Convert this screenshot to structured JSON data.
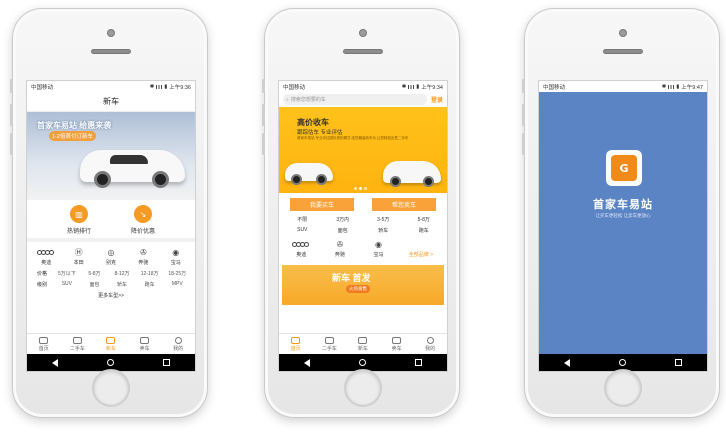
{
  "status": {
    "carrier": "中国移动",
    "time1": "上午9:36",
    "time2": "上午9:34",
    "time3": "上午9:47",
    "battery_icon": "battery-icon",
    "bluetooth_icon": "bluetooth-icon"
  },
  "tabbar": {
    "items": [
      "首页",
      "二手车",
      "新车",
      "卖车",
      "我的"
    ]
  },
  "screen1": {
    "title": "新车",
    "banner_headline": "首家车易站 给惠来袭",
    "banner_sub": "1-2倍首付订新车",
    "quick": [
      "热销排行",
      "降价优惠"
    ],
    "brands": [
      "奥迪",
      "本田",
      "别克",
      "奔驰",
      "宝马"
    ],
    "price_label": "价格",
    "prices": [
      "5万以下",
      "5-8万",
      "8-12万",
      "12-18万",
      "18-25万"
    ],
    "level_label": "级别",
    "levels": [
      "SUV",
      "面包",
      "轿车",
      "跑车",
      "MPV"
    ],
    "more": "更多车型>>"
  },
  "screen2": {
    "search_placeholder": "搜索您想要的车",
    "login": "登录",
    "banner_title": "高价收车",
    "banner_sub": "跟踪估车  专业评估",
    "banner_desc": "首家车易站 专业评估团队竞拍模式 给您最高收车价 让您轻松出售二手车",
    "buy_btn": "我要买车",
    "sell_btn": "帮您卖车",
    "row1": [
      "不限",
      "3万内",
      "3-5万",
      "5-8万"
    ],
    "row2": [
      "SUV",
      "面包",
      "轿车",
      "跑车"
    ],
    "brands": [
      "奥迪",
      "奔驰",
      "宝马"
    ],
    "all_brands": "全部品牌 >",
    "promo_title": "新车 首发",
    "promo_sub": "火热发售"
  },
  "screen3": {
    "logo_text": "G",
    "app_name": "首家车易站",
    "slogan": "让买车更轻松  让卖车更放心"
  },
  "colors": {
    "accent": "#f39a1e",
    "splash_bg": "#5b84c5"
  }
}
